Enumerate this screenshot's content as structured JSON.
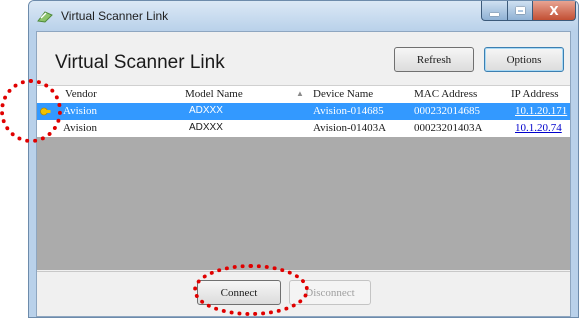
{
  "window": {
    "title": "Virtual Scanner Link",
    "minimize_icon": "minimize-icon",
    "maximize_icon": "maximize-icon",
    "close_label": "X"
  },
  "header": {
    "title": "Virtual Scanner Link",
    "refresh_label": "Refresh",
    "options_label": "Options"
  },
  "table": {
    "columns": [
      "Vendor",
      "Model Name",
      "Device Name",
      "MAC Address",
      "IP Address"
    ],
    "rows": [
      {
        "vendor": "Avision",
        "model": "ADXXX",
        "device": "Avision-014685",
        "mac": "000232014685",
        "ip": "10.1.20.171",
        "selected": true
      },
      {
        "vendor": "Avision",
        "model": "ADXXX",
        "device": "Avision-01403A",
        "mac": "00023201403A",
        "ip": "10.1.20.74",
        "selected": false
      }
    ]
  },
  "footer": {
    "connect_label": "Connect",
    "disconnect_label": "Disconnect"
  },
  "colors": {
    "selection": "#3399ff",
    "annotation": "#e00000"
  }
}
